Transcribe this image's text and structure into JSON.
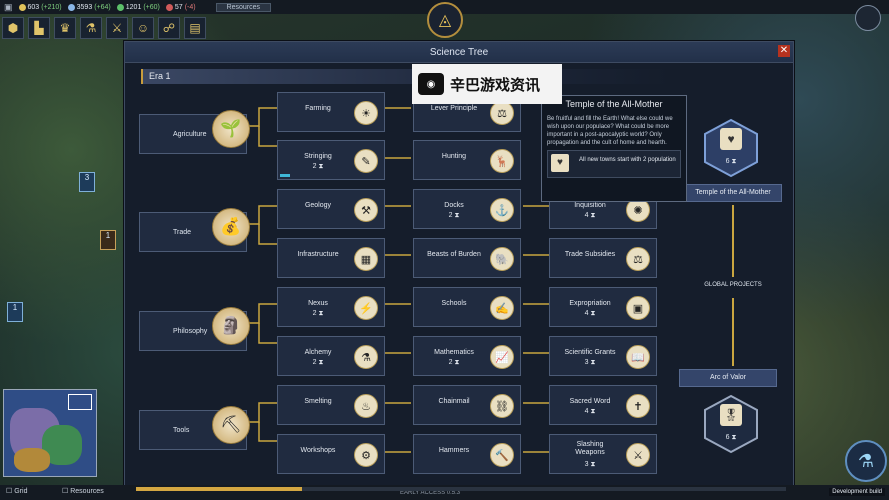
{
  "topbar": {
    "resources": [
      {
        "value": "603",
        "rate": "(+210)",
        "color": "#e0c25a"
      },
      {
        "value": "3593",
        "rate": "(+64)",
        "color": "#8ab6e6"
      },
      {
        "value": "1201",
        "rate": "(+60)",
        "color": "#5cc06a"
      },
      {
        "value": "57",
        "rate": "(-4)",
        "color": "#d05a5a"
      }
    ],
    "resources_button": "Resources"
  },
  "panel": {
    "title": "Science Tree",
    "close": "✕",
    "era": "Era 1"
  },
  "categories": [
    {
      "label": "Agriculture",
      "icon": "sprout-icon",
      "glyph": "🌱"
    },
    {
      "label": "Trade",
      "icon": "money-bag-icon",
      "glyph": "💰"
    },
    {
      "label": "Philosophy",
      "icon": "thinker-icon",
      "glyph": "🗿"
    },
    {
      "label": "Tools",
      "icon": "pickaxe-icon",
      "glyph": "⛏"
    }
  ],
  "techs": {
    "farming": {
      "name": "Farming",
      "cost": "",
      "glyph": "☀"
    },
    "stringing": {
      "name": "Stringing",
      "cost": "2 ⧗",
      "glyph": "✎"
    },
    "geology": {
      "name": "Geology",
      "cost": "",
      "glyph": "⚒"
    },
    "infrastructure": {
      "name": "Infrastructure",
      "cost": "",
      "glyph": "▦"
    },
    "nexus": {
      "name": "Nexus",
      "cost": "2 ⧗",
      "glyph": "⚡"
    },
    "alchemy": {
      "name": "Alchemy",
      "cost": "2 ⧗",
      "glyph": "⚗"
    },
    "smelting": {
      "name": "Smelting",
      "cost": "",
      "glyph": "♨"
    },
    "workshops": {
      "name": "Workshops",
      "cost": "",
      "glyph": "⚙"
    },
    "lever": {
      "name": "Lever Principle",
      "cost": "",
      "glyph": "⚖"
    },
    "hunting": {
      "name": "Hunting",
      "cost": "",
      "glyph": "🦌"
    },
    "docks": {
      "name": "Docks",
      "cost": "2 ⧗",
      "glyph": "⚓"
    },
    "beasts": {
      "name": "Beasts of Burden",
      "cost": "",
      "glyph": "🐘"
    },
    "schools": {
      "name": "Schools",
      "cost": "",
      "glyph": "✍"
    },
    "mathematics": {
      "name": "Mathematics",
      "cost": "2 ⧗",
      "glyph": "📈"
    },
    "chainmail": {
      "name": "Chainmail",
      "cost": "",
      "glyph": "⛓"
    },
    "hammers": {
      "name": "Hammers",
      "cost": "",
      "glyph": "🔨"
    },
    "inquisition": {
      "name": "Inquisition",
      "cost": "4 ⧗",
      "glyph": "✺"
    },
    "subsidies": {
      "name": "Trade Subsidies",
      "cost": "",
      "glyph": "⚖"
    },
    "expropriation": {
      "name": "Expropriation",
      "cost": "4 ⧗",
      "glyph": "▣"
    },
    "grants": {
      "name": "Scientific Grants",
      "cost": "3 ⧗",
      "glyph": "📖"
    },
    "sacred": {
      "name": "Sacred Word",
      "cost": "4 ⧗",
      "glyph": "✝"
    },
    "slashing": {
      "name": "Slashing\nWeapons",
      "cost": "3 ⧗",
      "glyph": "⚔"
    }
  },
  "tooltip": {
    "title": "Temple of the All-Mother",
    "body": "Be fruitful and fill the Earth! What else could we wish upon our populace? What could be more important in a post-apocalyptic world? Only propagation and the cult of home and hearth.",
    "effect": "All new towns start with 2 population",
    "effect_icon": "temple-icon"
  },
  "global_projects": {
    "label": "GLOBAL PROJECTS",
    "top": {
      "name": "Temple of the All-Mother",
      "cost": "6 ⧗",
      "glyph": "♥"
    },
    "bottom": {
      "name": "Arc of Valor",
      "cost": "6 ⧗",
      "glyph": "🎖"
    }
  },
  "watermark": {
    "text": "辛巴游戏资讯",
    "icon": "gamepad-icon"
  },
  "bottom": {
    "grid": "Grid",
    "resources": "Resources",
    "version": "EARLY ACCESS 0.5.3",
    "dev": "Development build"
  },
  "progress": 0.255
}
